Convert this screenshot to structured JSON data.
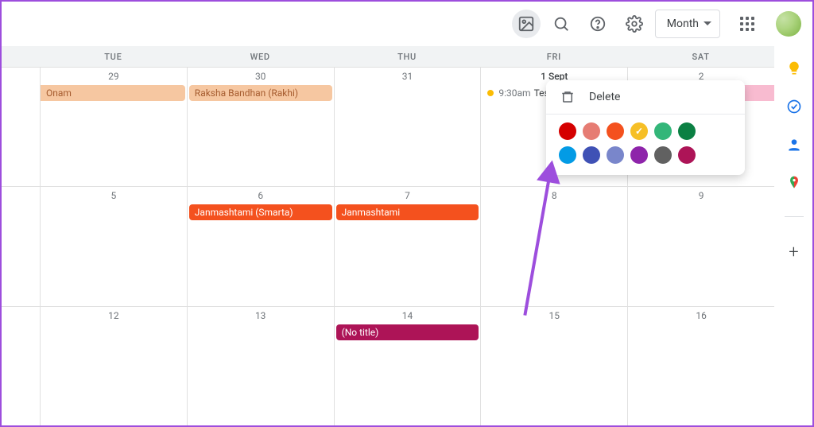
{
  "header": {
    "view_label": "Month"
  },
  "calendar": {
    "day_headers": [
      "TUE",
      "WED",
      "THU",
      "FRI",
      "SAT"
    ],
    "weeks": [
      {
        "days": [
          {
            "num": "29",
            "events": [
              {
                "label": "Onam",
                "style": "peach continue-left"
              }
            ]
          },
          {
            "num": "30",
            "events": [
              {
                "label": "Raksha Bandhan (Rakhi)",
                "style": "peach"
              }
            ]
          },
          {
            "num": "31",
            "events": []
          },
          {
            "num": "1 Sept",
            "first": true,
            "events": [
              {
                "timed": true,
                "time": "9:30am",
                "label": "Tes"
              }
            ]
          },
          {
            "num": "2",
            "events": [
              {
                "label": "",
                "style": "pink-fade continue-right"
              }
            ]
          }
        ]
      },
      {
        "days": [
          {
            "num": "5",
            "events": []
          },
          {
            "num": "6",
            "events": [
              {
                "label": "Janmashtami (Smarta)",
                "style": "orange"
              }
            ]
          },
          {
            "num": "7",
            "events": [
              {
                "label": "Janmashtami",
                "style": "orange"
              }
            ]
          },
          {
            "num": "8",
            "events": []
          },
          {
            "num": "9",
            "events": []
          }
        ]
      },
      {
        "days": [
          {
            "num": "12",
            "events": []
          },
          {
            "num": "13",
            "events": []
          },
          {
            "num": "14",
            "events": [
              {
                "label": "(No title)",
                "style": "magenta"
              }
            ]
          },
          {
            "num": "15",
            "events": []
          },
          {
            "num": "16",
            "events": []
          }
        ]
      }
    ]
  },
  "popover": {
    "delete_label": "Delete",
    "colors": [
      {
        "hex": "#d50000"
      },
      {
        "hex": "#e67c73"
      },
      {
        "hex": "#f4511e"
      },
      {
        "hex": "#f6bf26",
        "selected": true
      },
      {
        "hex": "#33b679"
      },
      {
        "hex": "#0b8043"
      },
      {
        "hex": "#039be5"
      },
      {
        "hex": "#3f51b5"
      },
      {
        "hex": "#7986cb"
      },
      {
        "hex": "#8e24aa"
      },
      {
        "hex": "#616161"
      },
      {
        "hex": "#ad1457"
      }
    ]
  },
  "side_icons": [
    "keep-icon",
    "tasks-icon",
    "contacts-icon",
    "maps-icon"
  ]
}
